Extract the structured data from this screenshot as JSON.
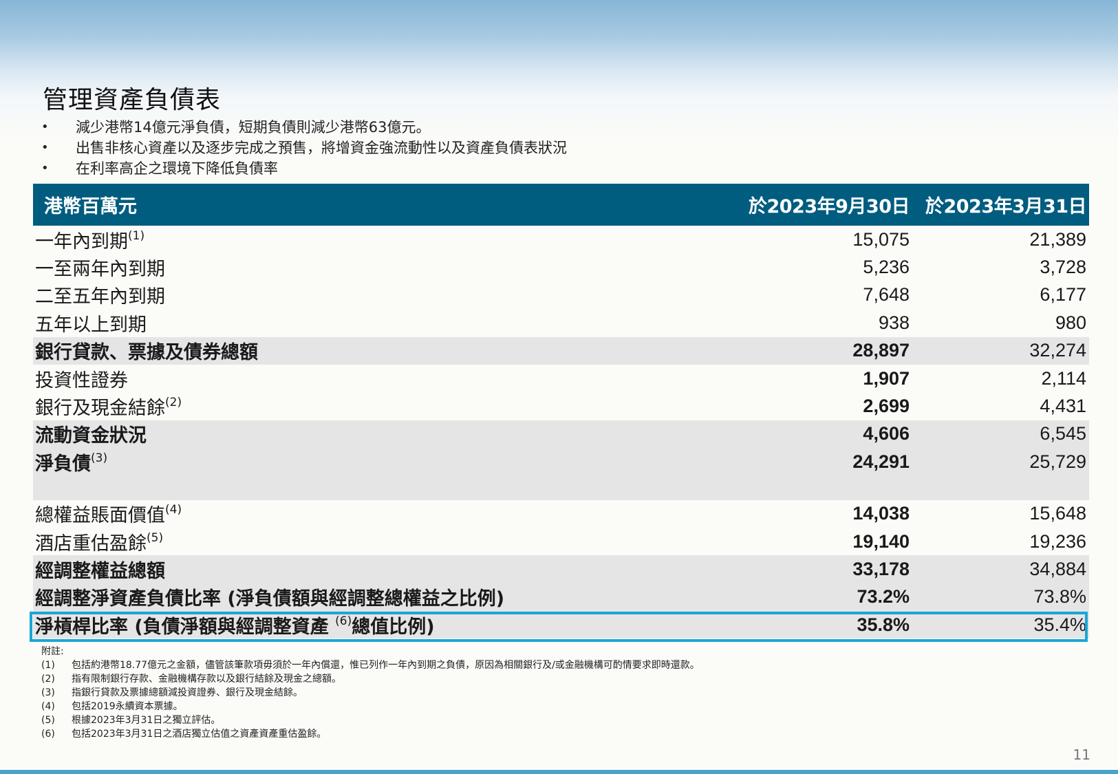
{
  "title": "管理資產負債表",
  "bullets": [
    "減少港幣14億元淨負債，短期負債則減少港幣63億元。",
    "出售非核心資產以及逐步完成之預售，將增資金強流動性以及資產負債表狀況",
    "在利率高企之環境下降低負債率"
  ],
  "table": {
    "header": {
      "label": "港幣百萬元",
      "col1": "於2023年9月30日",
      "col2": "於2023年3月31日"
    },
    "rows": [
      {
        "label": "一年內到期",
        "sup": "(1)",
        "v1": "15,075",
        "v2": "21,389"
      },
      {
        "label": "一至兩年內到期",
        "sup": "",
        "v1": "5,236",
        "v2": "3,728"
      },
      {
        "label": "二至五年內到期",
        "sup": "",
        "v1": "7,648",
        "v2": "6,177"
      },
      {
        "label": "五年以上到期",
        "sup": "",
        "v1": "938",
        "v2": "980"
      },
      {
        "label": "銀行貸款、票據及債券總額",
        "sup": "",
        "v1": "28,897",
        "v2": "32,274"
      },
      {
        "label": "投資性證券",
        "sup": "",
        "v1": "1,907",
        "v2": "2,114"
      },
      {
        "label": "銀行及現金結餘",
        "sup": "(2)",
        "v1": "2,699",
        "v2": "4,431"
      },
      {
        "label": "流動資金狀況",
        "sup": "",
        "v1": "4,606",
        "v2": "6,545"
      },
      {
        "label": "淨負債",
        "sup": "(3)",
        "v1": "24,291",
        "v2": "25,729"
      },
      {
        "label": "總權益賬面價值",
        "sup": "(4)",
        "v1": "14,038",
        "v2": "15,648"
      },
      {
        "label": "酒店重估盈餘",
        "sup": "(5)",
        "v1": "19,140",
        "v2": "19,236"
      },
      {
        "label": "經調整權益總額",
        "sup": "",
        "v1": "33,178",
        "v2": "34,884"
      },
      {
        "label": "經調整淨資產負債比率 (淨負債額與經調整總權益之比例)",
        "sup": "",
        "v1": "73.2%",
        "v2": "73.8%"
      },
      {
        "label": "淨槓桿比率 (負債淨額與經調整資產 ",
        "sup": "(6)",
        "label_tail": "總值比例)",
        "v1": "35.8%",
        "v2": "35.4%"
      }
    ]
  },
  "notes": {
    "heading": "附註:",
    "items": [
      {
        "num": "(1)",
        "text": "包括約港幣18.77億元之金額，儘管該筆款項毋須於一年內償還，惟已列作一年內到期之負債，原因為相關銀行及/或金融機構可酌情要求即時還款。"
      },
      {
        "num": "(2)",
        "text": "指有限制銀行存款、金融機構存款以及銀行結餘及現金之總額。"
      },
      {
        "num": "(3)",
        "text": "指銀行貸款及票據總額減投資證券、銀行及現金結餘。"
      },
      {
        "num": "(4)",
        "text": "包括2019永續資本票據。"
      },
      {
        "num": "(5)",
        "text": "根據2023年3月31日之獨立評估。"
      },
      {
        "num": "(6)",
        "text": "包括2023年3月31日之酒店獨立估值之資產資產重估盈餘。"
      }
    ]
  },
  "page_number": "11",
  "colors": {
    "header_bg": "#005d7f",
    "shaded_row": "#e5e5e5",
    "highlight_border": "#19a7d6"
  }
}
